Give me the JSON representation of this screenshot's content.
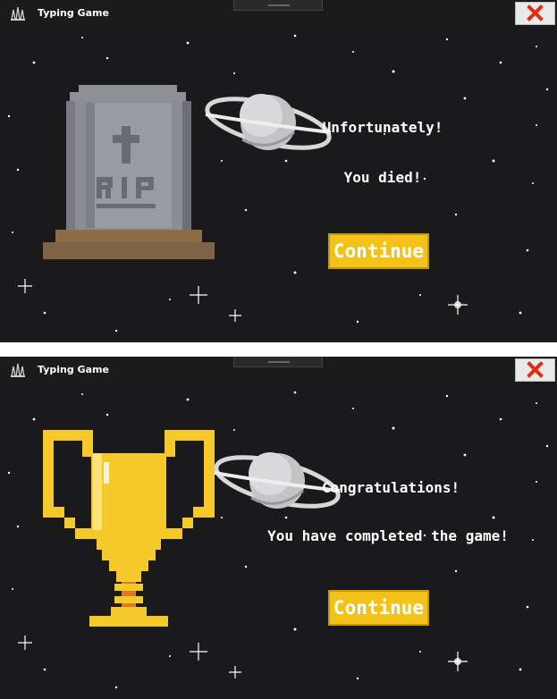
{
  "app": {
    "title": "Typing Game"
  },
  "screens": [
    {
      "id": "game-over",
      "messages": [
        "Unfortunately!",
        "You died!"
      ],
      "tombstone_text": "RIP",
      "continue_label": "Continue"
    },
    {
      "id": "victory",
      "messages": [
        "Congratulations!",
        "You have completed the game!"
      ],
      "continue_label": "Continue"
    }
  ],
  "colors": {
    "button": "#f2c21a",
    "close_icon": "#e32b10",
    "trophy": "#f5c92a",
    "tombstone": "#8c8c95"
  },
  "icons": [
    "app-icon",
    "close-icon",
    "planet-icon",
    "tombstone-icon",
    "trophy-icon"
  ]
}
